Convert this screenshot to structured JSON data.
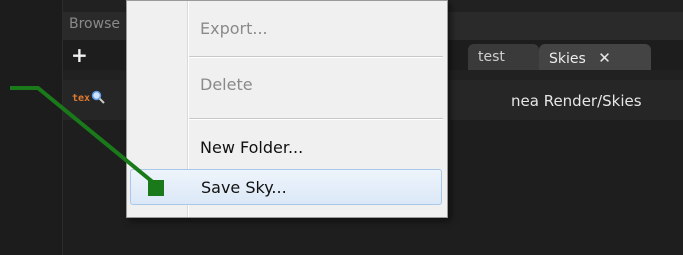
{
  "browser": {
    "title": "Browse",
    "add_label": "+",
    "tabs": [
      {
        "label": "test"
      },
      {
        "label": "Skies",
        "close": "✕"
      }
    ],
    "path_text": "nea Render/Skies",
    "tex_icon": "tex"
  },
  "context_menu": {
    "items": [
      {
        "label": "Export...",
        "enabled": false
      },
      {
        "label": "Delete",
        "enabled": false
      },
      {
        "label": "New Folder...",
        "enabled": true
      },
      {
        "label": "Save Sky...",
        "enabled": true,
        "highlighted": true
      }
    ]
  },
  "colors": {
    "annotation": "#1a7a1a",
    "menu_background": "#f0f0f0",
    "highlight_border": "#a8c8ea"
  }
}
